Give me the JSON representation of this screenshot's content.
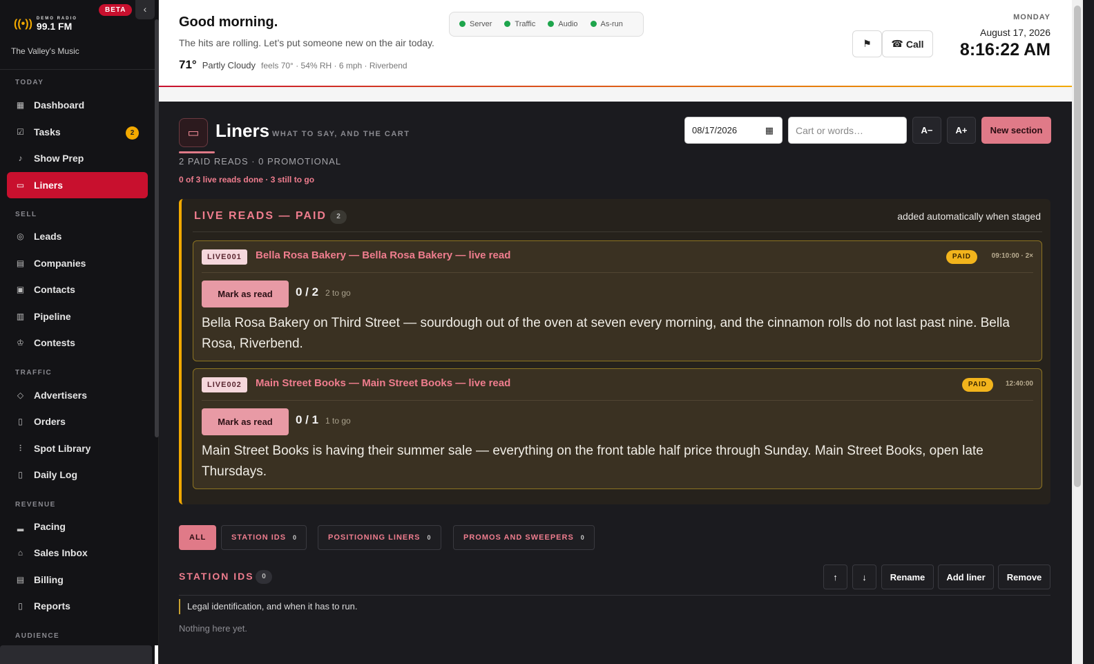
{
  "brand": {
    "logo_small": "DEMO RADIO",
    "logo_big": "99.1 FM",
    "tagline": "The Valley's Music",
    "beta": "BETA"
  },
  "sidebar": {
    "sections": {
      "today": "TODAY",
      "sell": "SELL",
      "traffic": "TRAFFIC",
      "revenue": "REVENUE",
      "audience": "AUDIENCE"
    },
    "items": [
      {
        "label": "Dashboard",
        "icon": "dashboard-icon"
      },
      {
        "label": "Tasks",
        "icon": "tasks-icon",
        "badge": "2"
      },
      {
        "label": "Show Prep",
        "icon": "microphone-icon"
      },
      {
        "label": "Liners",
        "icon": "chat-icon",
        "active": true
      },
      {
        "label": "Leads",
        "icon": "target-icon"
      },
      {
        "label": "Companies",
        "icon": "building-icon"
      },
      {
        "label": "Contacts",
        "icon": "contact-card-icon"
      },
      {
        "label": "Pipeline",
        "icon": "pipeline-icon"
      },
      {
        "label": "Contests",
        "icon": "trophy-icon"
      },
      {
        "label": "Advertisers",
        "icon": "tag-icon"
      },
      {
        "label": "Orders",
        "icon": "document-icon"
      },
      {
        "label": "Spot Library",
        "icon": "audio-wave-icon"
      },
      {
        "label": "Daily Log",
        "icon": "log-icon"
      },
      {
        "label": "Pacing",
        "icon": "bar-chart-icon"
      },
      {
        "label": "Sales Inbox",
        "icon": "inbox-icon"
      },
      {
        "label": "Billing",
        "icon": "billing-icon"
      },
      {
        "label": "Reports",
        "icon": "report-icon"
      }
    ]
  },
  "header": {
    "greeting": "Good morning.",
    "subtitle": "The hits are rolling. Let’s put someone new on the air today.",
    "weather": {
      "temp": "71°",
      "condition": "Partly Cloudy",
      "details": "feels 70° · 54% RH · 6 mph · Riverbend"
    },
    "status": [
      "Server",
      "Traffic",
      "Audio",
      "As-run"
    ],
    "call_label": "Call",
    "day": "MONDAY",
    "date": "August 17, 2026",
    "time": "8:16:22 AM"
  },
  "page": {
    "title": "Liners",
    "subtitle": "WHAT TO SAY, AND THE CART",
    "paid_summary": "2 PAID READS · 0 PROMOTIONAL",
    "reads_done": "0 of 3 live reads done · 3 still to go",
    "date_value": "08/17/2026",
    "search_placeholder": "Cart or words…",
    "font_down": "A−",
    "font_up": "A+",
    "new_section": "New section"
  },
  "live_reads": {
    "title": "LIVE READS — PAID",
    "count": "2",
    "note": "added automatically when staged",
    "cards": [
      {
        "code": "LIVE001",
        "title": "Bella Rosa Bakery — Bella Rosa Bakery — live read",
        "tag": "PAID",
        "time": "09:10:00 · 2×",
        "button": "Mark as read",
        "progress": "0 / 2",
        "togo": "2 to go",
        "body": "Bella Rosa Bakery on Third Street — sourdough out of the oven at seven every morning, and the cinnamon rolls do not last past nine. Bella Rosa, Riverbend."
      },
      {
        "code": "LIVE002",
        "title": "Main Street Books — Main Street Books — live read",
        "tag": "PAID",
        "time": "12:40:00",
        "button": "Mark as read",
        "progress": "0 / 1",
        "togo": "1 to go",
        "body": "Main Street Books is having their summer sale — everything on the front table half price through Sunday. Main Street Books, open late Thursdays."
      }
    ]
  },
  "filters": [
    {
      "label": "ALL",
      "active": true
    },
    {
      "label": "STATION IDS",
      "count": "0"
    },
    {
      "label": "POSITIONING LINERS",
      "count": "0"
    },
    {
      "label": "PROMOS AND SWEEPERS",
      "count": "0"
    }
  ],
  "station_ids": {
    "title": "STATION IDS",
    "count": "0",
    "buttons": {
      "up": "↑",
      "down": "↓",
      "rename": "Rename",
      "add": "Add liner",
      "remove": "Remove"
    },
    "description": "Legal identification, and when it has to run.",
    "empty": "Nothing here yet."
  },
  "colors": {
    "accent": "#c8102e",
    "pink": "#e07a88",
    "gold": "#f2a900",
    "status_ok": "#1ea54c"
  }
}
